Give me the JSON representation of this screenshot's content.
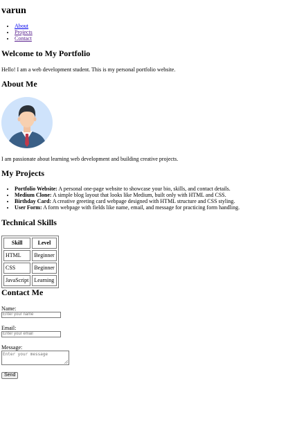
{
  "site": {
    "title": "varun"
  },
  "nav": {
    "items": [
      "About",
      "Projects",
      "Contact"
    ]
  },
  "hero": {
    "heading": "Welcome to My Portfolio",
    "text": "Hello! I am a web development student. This is my personal portfolio website."
  },
  "about": {
    "heading": "About Me",
    "avatar_icon": "person-avatar-icon",
    "text": "I am passionate about learning web development and building creative projects."
  },
  "projects": {
    "heading": "My Projects",
    "items": [
      {
        "name": "Portfolio Website:",
        "desc": "A personal one-page website to showcase your bio, skills, and contact details."
      },
      {
        "name": "Medium Clone:",
        "desc": "A simple blog layout that looks like Medium, built only with HTML and CSS."
      },
      {
        "name": "Birthday Card:",
        "desc": "A creative greeting card webpage designed with HTML structure and CSS styling."
      },
      {
        "name": "User Form:",
        "desc": "A form webpage with fields like name, email, and message for practicing form handling."
      }
    ]
  },
  "skills": {
    "heading": "Technical Skills",
    "columns": [
      "Skill",
      "Level"
    ],
    "rows": [
      [
        "HTML",
        "Beginner"
      ],
      [
        "CSS",
        "Beginner"
      ],
      [
        "JavaScript",
        "Learning"
      ]
    ]
  },
  "contact": {
    "heading": "Contact Me",
    "name_label": "Name:",
    "name_placeholder": "Enter your name",
    "email_label": "Email:",
    "email_placeholder": "Enter your email",
    "message_label": "Message:",
    "message_placeholder": "Enter your message",
    "send_label": "Send"
  },
  "colors": {
    "link": "#0000ee",
    "visited": "#551a8b"
  }
}
